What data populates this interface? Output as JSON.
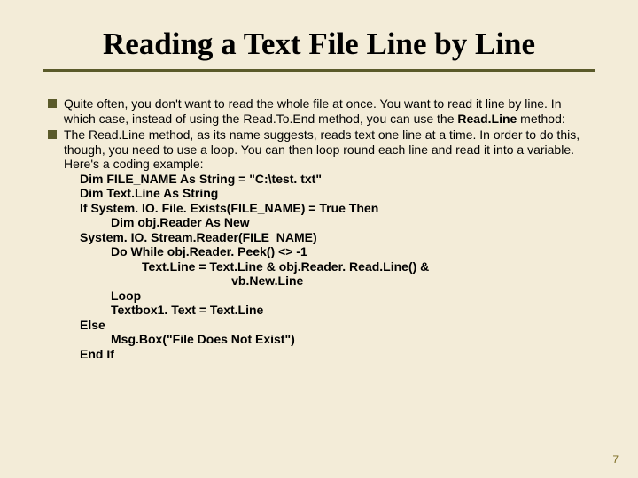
{
  "title": "Reading a Text File Line by Line",
  "bullets": [
    {
      "text_pre": "Quite often, you don't want to read the whole file at once. You want to read it line by line. In which case, instead of using the Read.To.End method, you can use the ",
      "bold": "Read.Line",
      "text_post": " method:"
    },
    {
      "text_pre": "The Read.Line method, as its name suggests, reads text one line at a time. In order to do this, though, you need to use a loop. You can then loop round each line and read it into a variable. Here's a coding example:",
      "bold": "",
      "text_post": ""
    }
  ],
  "code": [
    "Dim FILE_NAME As String = \"C:\\test. txt\"",
    "Dim Text.Line As String",
    "If System. IO. File. Exists(FILE_NAME) = True Then",
    "         Dim obj.Reader As New",
    "System. IO. Stream.Reader(FILE_NAME)",
    "         Do While obj.Reader. Peek() <> -1",
    "                  Text.Line = Text.Line & obj.Reader. Read.Line() &",
    "                                            vb.New.Line",
    "         Loop",
    "         Textbox1. Text = Text.Line",
    "Else",
    "         Msg.Box(\"File Does Not Exist\")",
    "End If"
  ],
  "page_number": "7"
}
